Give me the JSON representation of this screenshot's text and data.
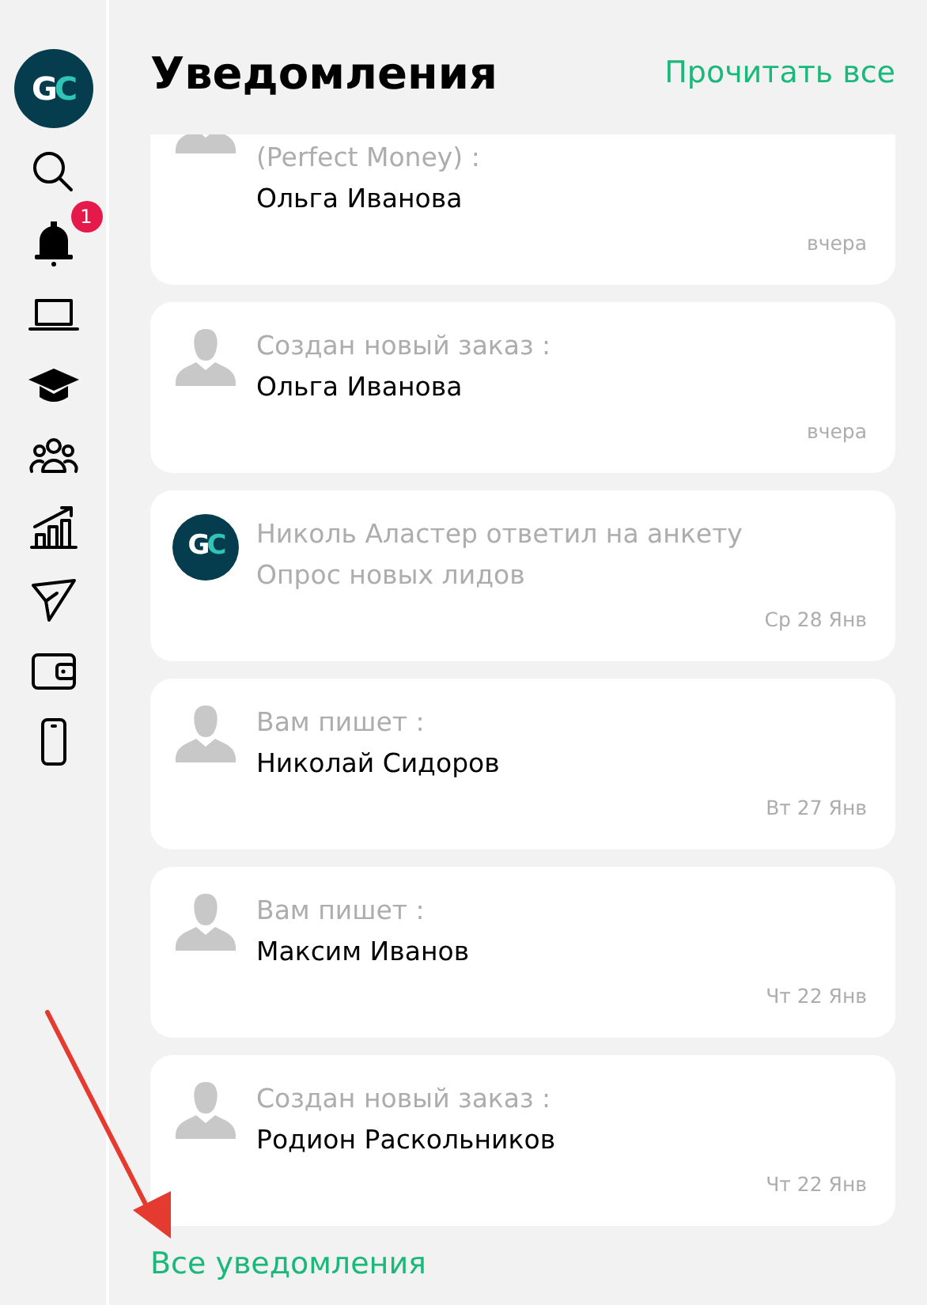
{
  "sidebar": {
    "items": [
      {
        "kind": "logo",
        "logo_text": "GC"
      },
      {
        "kind": "search"
      },
      {
        "kind": "bell",
        "badge": "1"
      },
      {
        "kind": "laptop"
      },
      {
        "kind": "cap"
      },
      {
        "kind": "people"
      },
      {
        "kind": "chart"
      },
      {
        "kind": "send"
      },
      {
        "kind": "wallet"
      },
      {
        "kind": "phone"
      }
    ]
  },
  "header": {
    "title": "Уведомления",
    "action": "Прочитать все"
  },
  "notifications": [
    {
      "kind": "person",
      "lines": [
        {
          "text": "(Perfect Money) :",
          "kind": "event"
        },
        {
          "text": "Ольга Иванова",
          "kind": "name"
        }
      ],
      "date": "вчера"
    },
    {
      "kind": "person",
      "lines": [
        {
          "text": "Создан новый заказ :",
          "kind": "event"
        },
        {
          "text": "Ольга Иванова",
          "kind": "name"
        }
      ],
      "date": "вчера"
    },
    {
      "kind": "logo",
      "logo_text": "GC",
      "lines": [
        {
          "text": "Николь Аластер ответил на анкету",
          "kind": "event"
        },
        {
          "text": "Опрос новых лидов",
          "kind": "event"
        }
      ],
      "date": "Ср 28 Янв"
    },
    {
      "kind": "person",
      "lines": [
        {
          "text": "Вам пишет :",
          "kind": "event"
        },
        {
          "text": "Николай Сидоров",
          "kind": "name"
        }
      ],
      "date": "Вт 27 Янв"
    },
    {
      "kind": "person",
      "lines": [
        {
          "text": "Вам пишет :",
          "kind": "event"
        },
        {
          "text": "Максим Иванов",
          "kind": "name"
        }
      ],
      "date": "Чт 22 Янв"
    },
    {
      "kind": "person",
      "lines": [
        {
          "text": "Создан новый заказ :",
          "kind": "event"
        },
        {
          "text": "Родион Раскольников",
          "kind": "name"
        }
      ],
      "date": "Чт 22 Янв"
    }
  ],
  "footer_link": "Все уведомления"
}
